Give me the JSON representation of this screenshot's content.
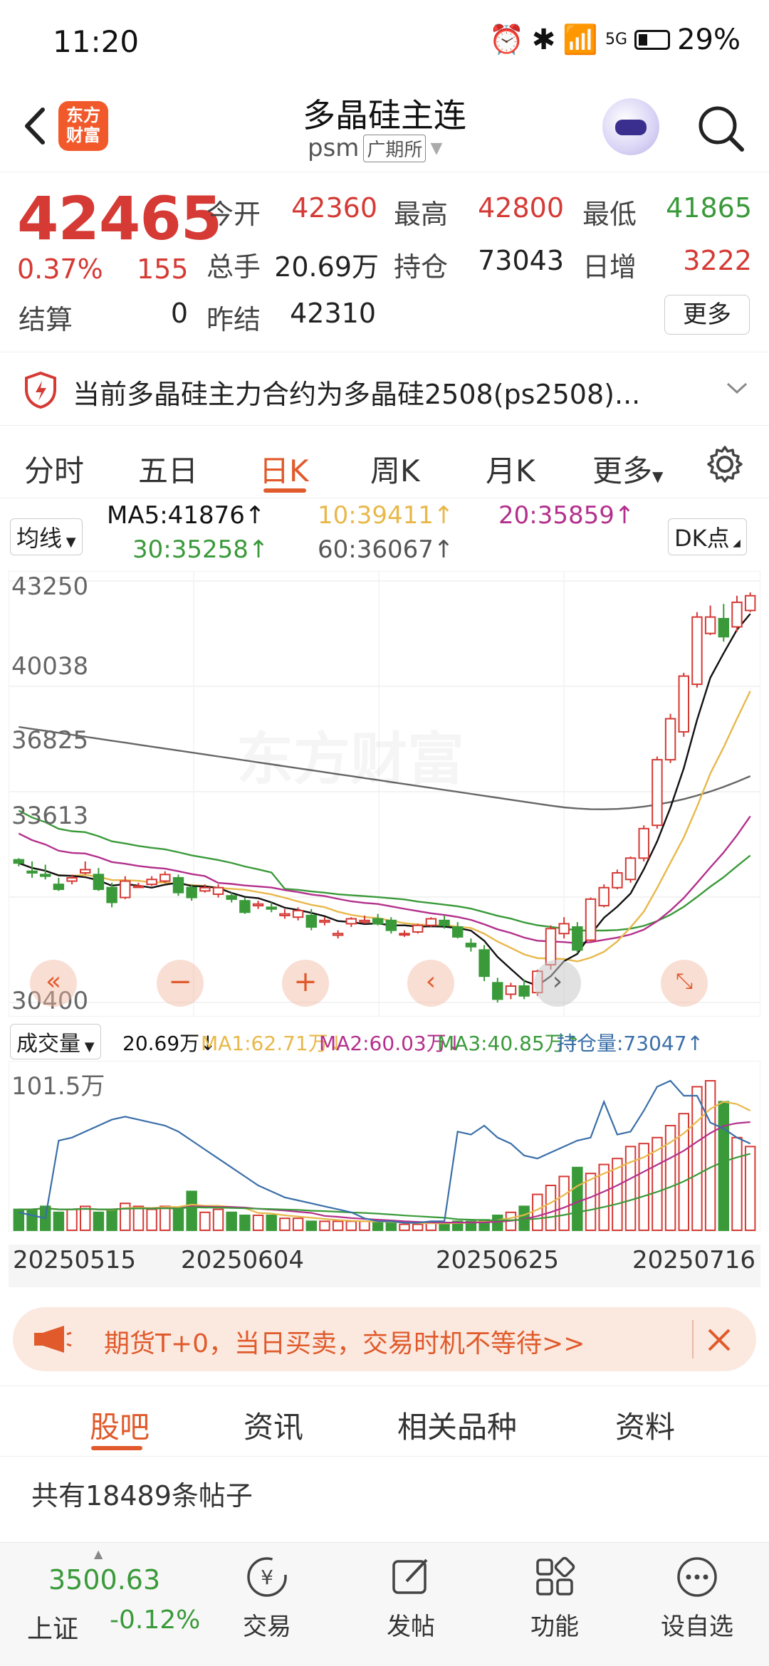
{
  "status": {
    "time": "11:20",
    "signal": "5G",
    "battery": "29%"
  },
  "nav": {
    "logo": "东方财富",
    "title": "多晶硅主连",
    "code": "psm",
    "exchange": "广期所"
  },
  "quote": {
    "price": "42465",
    "pct": "0.37%",
    "change": "155",
    "open_label": "今开",
    "open": "42360",
    "high_label": "最高",
    "high": "42800",
    "low_label": "最低",
    "low": "41865",
    "vol_label": "总手",
    "vol": "20.69万",
    "oi_label": "持仓",
    "oi": "73043",
    "dayinc_label": "日增",
    "dayinc": "3222",
    "settle_label": "结算",
    "settle": "0",
    "prev_label": "昨结",
    "prev": "42310",
    "more": "更多"
  },
  "notice": {
    "text": "当前多晶硅主力合约为多晶硅2508(ps2508)..."
  },
  "tabs": [
    "分时",
    "五日",
    "日K",
    "周K",
    "月K",
    "更多"
  ],
  "ma": {
    "selector": "均线",
    "ma5": "MA5:41876↑",
    "ma10": "10:39411↑",
    "ma20": "20:35859↑",
    "ma30": "30:35258↑",
    "ma60": "60:36067↑",
    "dk": "DK点"
  },
  "kaxis": [
    "43250",
    "40038",
    "36825",
    "33613",
    "30400"
  ],
  "volbar": {
    "selector": "成交量",
    "vol": "20.69万↓",
    "ma1": "MA1:62.71万↓",
    "ma2": "MA2:60.03万↓",
    "ma3": "MA3:40.85万↑",
    "oi": "持仓量:73047↑",
    "ymax": "101.5万"
  },
  "xaxis": [
    "20250515",
    "20250604",
    "20250625",
    "20250716"
  ],
  "watermark": "东方财富",
  "promo": {
    "text": "期货T+0，当日买卖，交易时机不等待>>"
  },
  "btabs": [
    "股吧",
    "资讯",
    "相关品种",
    "资料"
  ],
  "posts": "共有18489条帖子",
  "bottom": {
    "index": "3500.63",
    "index_name": "上证",
    "index_pct": "-0.12%",
    "items": [
      "交易",
      "发帖",
      "功能",
      "设自选"
    ]
  },
  "colors": {
    "up": "#d53a35",
    "down": "#3a9a3a",
    "accent": "#e05a2b"
  },
  "chart_data": {
    "type": "candlestick",
    "x": [
      "20250515",
      "20250604",
      "20250625",
      "20250716"
    ],
    "ylim": [
      30400,
      43250
    ],
    "candles": [
      [
        34750,
        34650,
        34800,
        34550
      ],
      [
        34400,
        34350,
        34700,
        34200
      ],
      [
        34300,
        34250,
        34600,
        34150
      ],
      [
        34000,
        33850,
        34200,
        33800
      ],
      [
        34100,
        34200,
        34300,
        34000
      ],
      [
        34350,
        34450,
        34700,
        34300
      ],
      [
        34300,
        33850,
        34500,
        33800
      ],
      [
        33900,
        33450,
        34050,
        33300
      ],
      [
        33600,
        34100,
        34250,
        33550
      ],
      [
        33950,
        33950,
        34050,
        33900
      ],
      [
        34000,
        34150,
        34250,
        33950
      ],
      [
        34100,
        34300,
        34400,
        34050
      ],
      [
        34200,
        33750,
        34300,
        33650
      ],
      [
        33900,
        33600,
        34000,
        33500
      ],
      [
        33800,
        33900,
        34000,
        33750
      ],
      [
        33700,
        33900,
        34000,
        33600
      ],
      [
        33650,
        33550,
        33750,
        33450
      ],
      [
        33500,
        33150,
        33600,
        33100
      ],
      [
        33350,
        33400,
        33500,
        33250
      ],
      [
        33300,
        33250,
        33450,
        33150
      ],
      [
        33050,
        33100,
        33250,
        32950
      ],
      [
        33000,
        33200,
        33300,
        32900
      ],
      [
        33050,
        32700,
        33250,
        32600
      ],
      [
        32850,
        32900,
        33000,
        32750
      ],
      [
        32450,
        32500,
        32600,
        32350
      ],
      [
        32800,
        32950,
        33000,
        32700
      ],
      [
        32850,
        32900,
        33050,
        32800
      ],
      [
        32950,
        32800,
        33100,
        32750
      ],
      [
        32900,
        32600,
        33000,
        32500
      ],
      [
        32500,
        32500,
        32600,
        32400
      ],
      [
        32550,
        32750,
        32800,
        32500
      ],
      [
        32750,
        32950,
        33000,
        32700
      ],
      [
        32900,
        32750,
        33050,
        32650
      ],
      [
        32700,
        32400,
        32850,
        32350
      ],
      [
        32200,
        32100,
        32350,
        31950
      ],
      [
        32000,
        31200,
        32150,
        31050
      ],
      [
        31000,
        30500,
        31150,
        30400
      ],
      [
        30650,
        30900,
        31000,
        30500
      ],
      [
        30900,
        30600,
        31100,
        30500
      ],
      [
        30700,
        31350,
        31400,
        30600
      ],
      [
        31550,
        32650,
        32750,
        31400
      ],
      [
        32500,
        32800,
        33000,
        32350
      ],
      [
        32700,
        32000,
        32850,
        31900
      ],
      [
        32300,
        33550,
        33600,
        32250
      ],
      [
        33350,
        33900,
        34000,
        33300
      ],
      [
        33900,
        34350,
        34450,
        33850
      ],
      [
        34150,
        34800,
        34850,
        34050
      ],
      [
        34800,
        35700,
        35800,
        34700
      ],
      [
        35800,
        37800,
        37900,
        35700
      ],
      [
        37800,
        39050,
        39200,
        37700
      ],
      [
        38650,
        40350,
        40450,
        38500
      ],
      [
        40100,
        42150,
        42300,
        40000
      ],
      [
        41650,
        42150,
        42500,
        41600
      ],
      [
        42100,
        41550,
        42550,
        41400
      ],
      [
        41850,
        42600,
        42800,
        41700
      ],
      [
        42350,
        42800,
        42900,
        42300
      ]
    ],
    "series": [
      {
        "name": "MA5",
        "values": [
          41876
        ]
      },
      {
        "name": "MA10",
        "values": [
          39411
        ]
      },
      {
        "name": "MA20",
        "values": [
          35859
        ]
      },
      {
        "name": "MA30",
        "values": [
          35258
        ]
      },
      {
        "name": "MA60",
        "values": [
          36067
        ]
      }
    ]
  }
}
